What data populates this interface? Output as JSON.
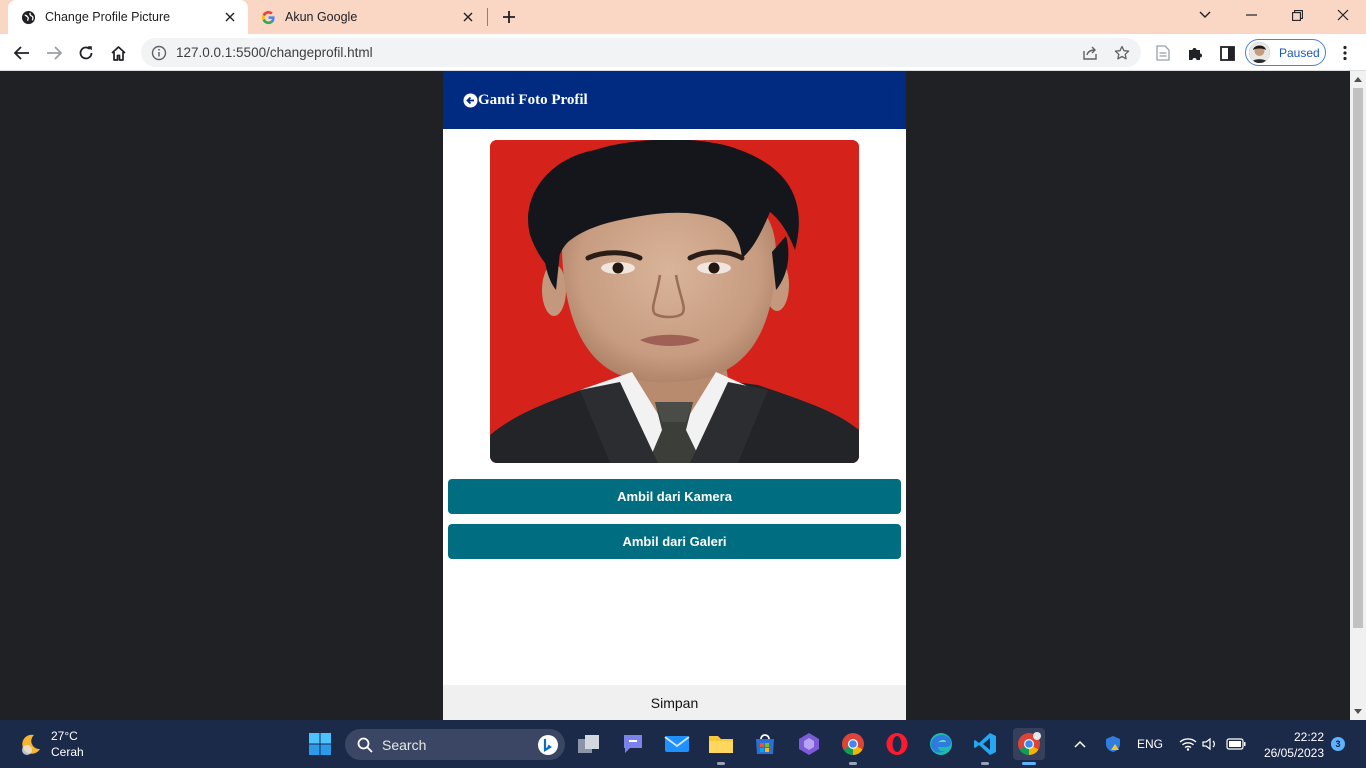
{
  "browser": {
    "tabs": [
      {
        "title": "Change Profile Picture",
        "active": true,
        "icon": "globe-icon"
      },
      {
        "title": "Akun Google",
        "active": false,
        "icon": "google-icon"
      }
    ],
    "url": "127.0.0.1:5500/changeprofil.html",
    "profile_label": "Paused"
  },
  "app": {
    "header_title": "Ganti Foto Profil",
    "buttons": {
      "camera": "Ambil dari Kamera",
      "gallery": "Ambil dari Galeri"
    },
    "save_label": "Simpan",
    "colors": {
      "header": "#002b80",
      "button": "#006d80",
      "photo_background": "#d5231c"
    }
  },
  "taskbar": {
    "weather": {
      "temp": "27°C",
      "condition": "Cerah"
    },
    "search_label": "Search",
    "language": "ENG",
    "time": "22:22",
    "date": "26/05/2023",
    "notification_count": "3"
  }
}
